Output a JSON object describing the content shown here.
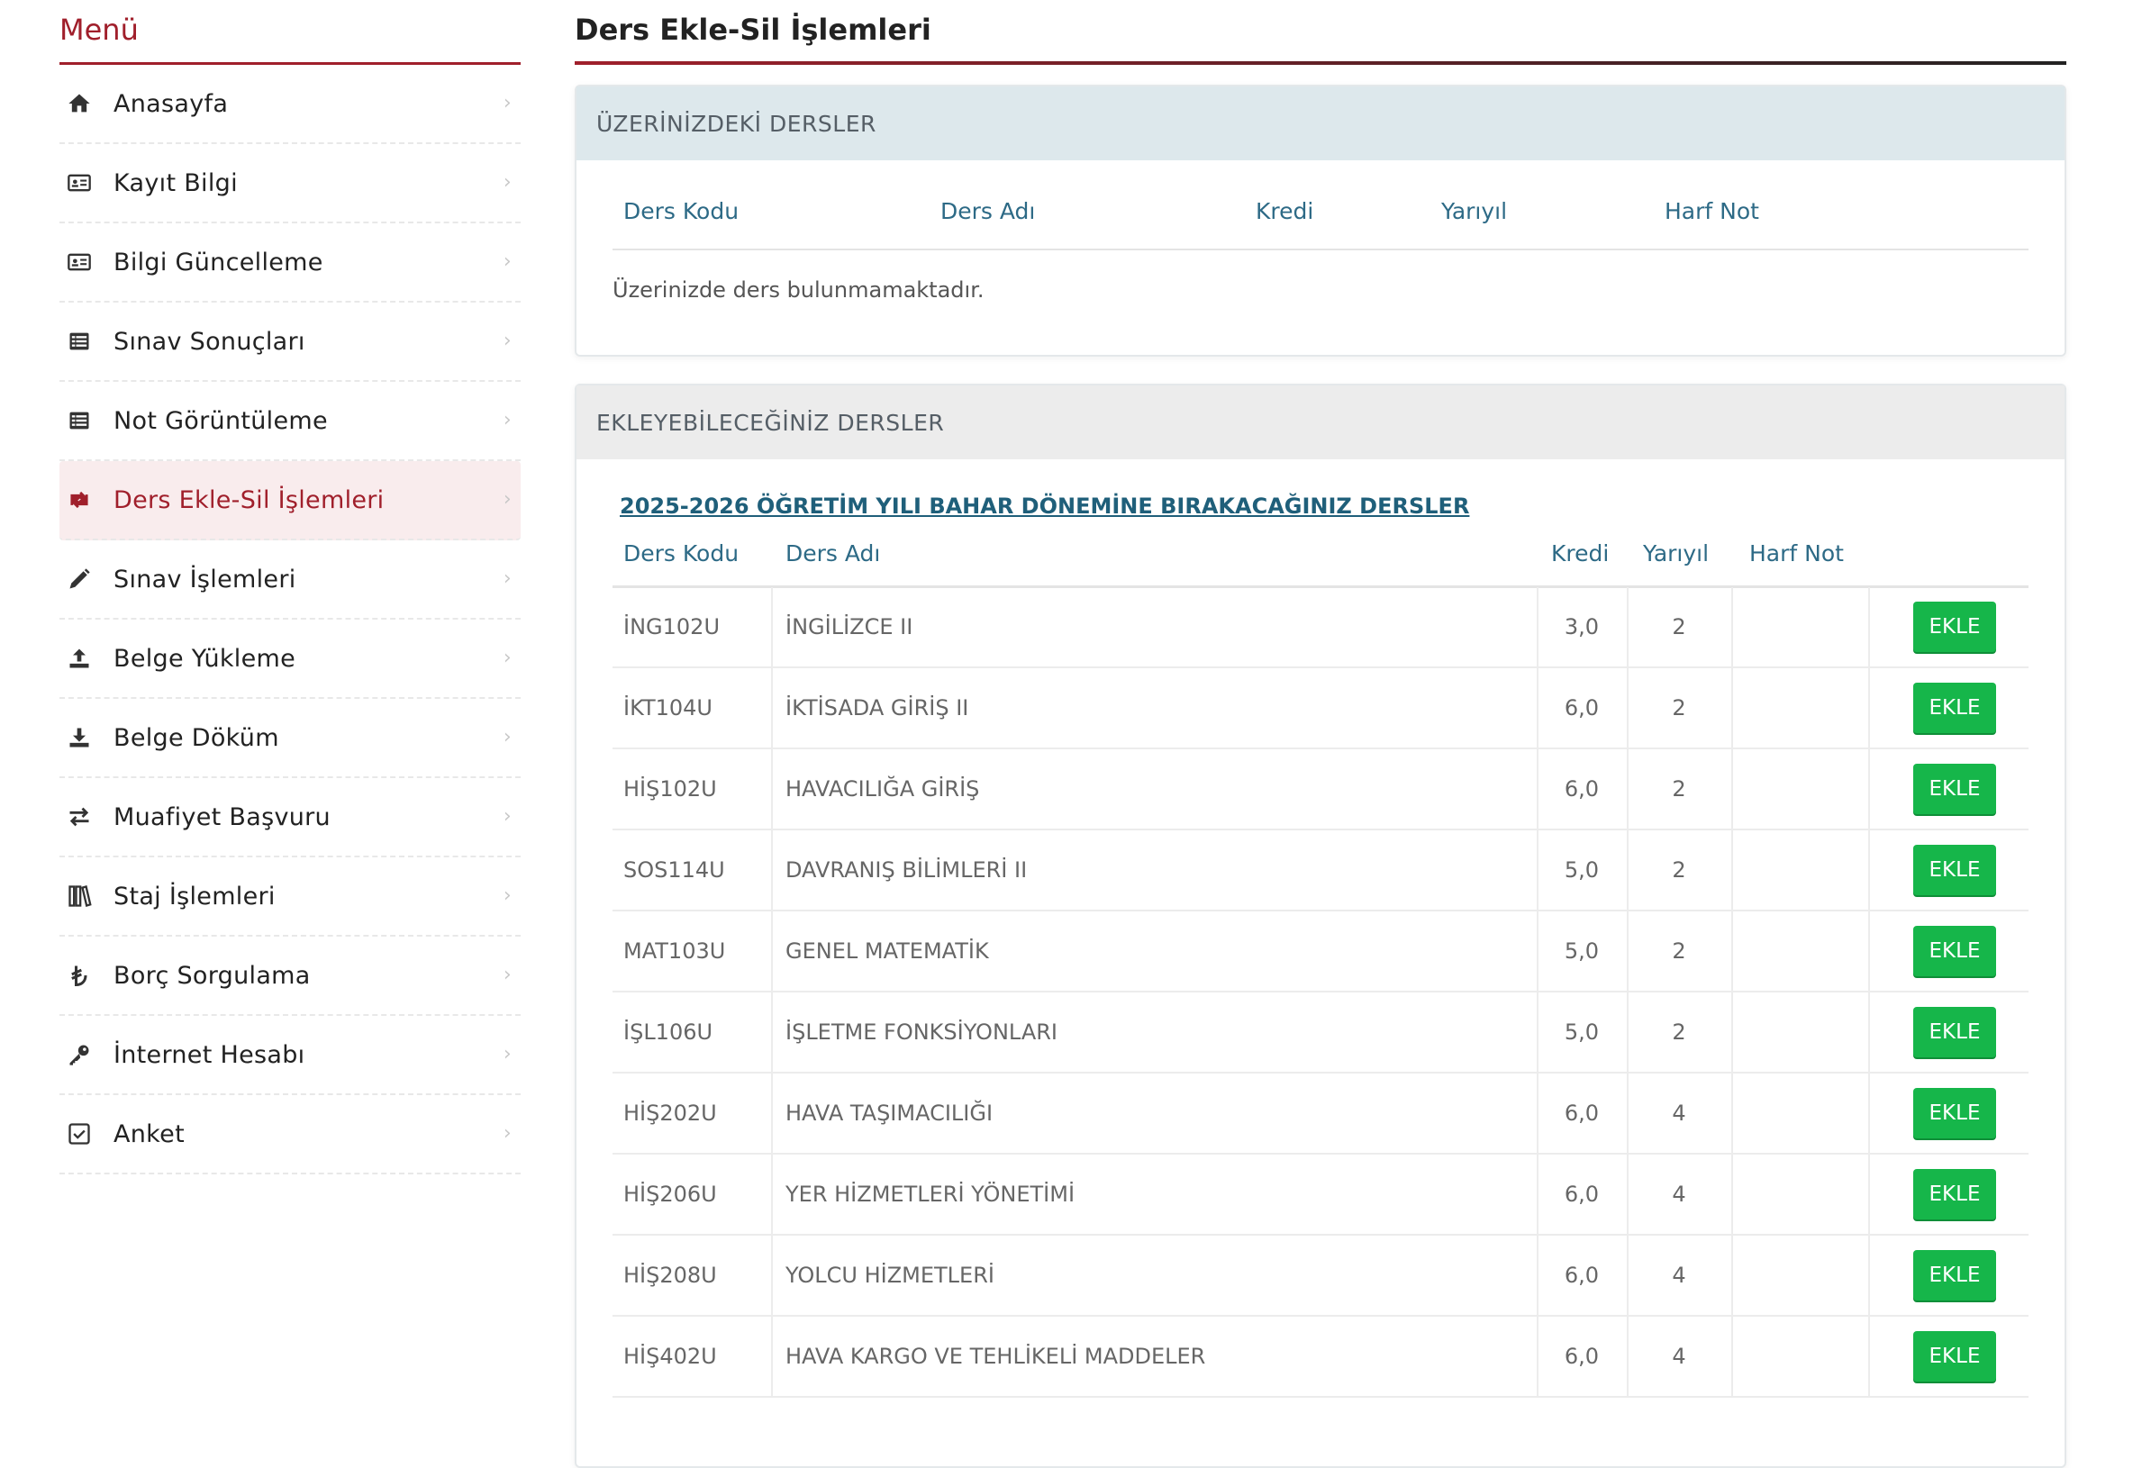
{
  "sidebar": {
    "title": "Menü",
    "items": [
      {
        "label": "Anasayfa",
        "icon": "home-icon"
      },
      {
        "label": "Kayıt Bilgi",
        "icon": "id-card-icon"
      },
      {
        "label": "Bilgi Güncelleme",
        "icon": "id-card-icon"
      },
      {
        "label": "Sınav Sonuçları",
        "icon": "list-icon"
      },
      {
        "label": "Not Görüntüleme",
        "icon": "list-icon"
      },
      {
        "label": "Ders Ekle-Sil İşlemleri",
        "icon": "retweet-icon",
        "active": true
      },
      {
        "label": "Sınav İşlemleri",
        "icon": "pencil-icon"
      },
      {
        "label": "Belge Yükleme",
        "icon": "upload-icon"
      },
      {
        "label": "Belge Döküm",
        "icon": "download-icon"
      },
      {
        "label": "Muafiyet Başvuru",
        "icon": "exchange-icon"
      },
      {
        "label": "Staj İşlemleri",
        "icon": "books-icon"
      },
      {
        "label": "Borç Sorgulama",
        "icon": "lira-icon"
      },
      {
        "label": "İnternet Hesabı",
        "icon": "key-icon"
      },
      {
        "label": "Anket",
        "icon": "checkbox-icon"
      }
    ]
  },
  "main": {
    "title": "Ders Ekle-Sil İşlemleri",
    "current_panel": {
      "title": "ÜZERİNİZDEKİ DERSLER",
      "columns": [
        "Ders Kodu",
        "Ders Adı",
        "Kredi",
        "Yarıyıl",
        "Harf Not"
      ],
      "empty_message": "Üzerinizde ders bulunmamaktadır."
    },
    "available_panel": {
      "title": "EKLEYEBİLECEĞİNİZ DERSLER",
      "subtitle_link": "2025-2026 ÖĞRETİM YILI BAHAR DÖNEMİNE BIRAKACAĞINIZ DERSLER",
      "columns": [
        "Ders Kodu",
        "Ders Adı",
        "Kredi",
        "Yarıyıl",
        "Harf Not"
      ],
      "add_label": "EKLE",
      "rows": [
        {
          "code": "İNG102U",
          "name": "İNGİLİZCE II",
          "credit": "3,0",
          "semester": "2",
          "grade": ""
        },
        {
          "code": "İKT104U",
          "name": "İKTİSADA GİRİŞ II",
          "credit": "6,0",
          "semester": "2",
          "grade": ""
        },
        {
          "code": "HİŞ102U",
          "name": "HAVACILIĞA GİRİŞ",
          "credit": "6,0",
          "semester": "2",
          "grade": ""
        },
        {
          "code": "SOS114U",
          "name": "DAVRANIŞ BİLİMLERİ II",
          "credit": "5,0",
          "semester": "2",
          "grade": ""
        },
        {
          "code": "MAT103U",
          "name": "GENEL MATEMATİK",
          "credit": "5,0",
          "semester": "2",
          "grade": ""
        },
        {
          "code": "İŞL106U",
          "name": "İŞLETME FONKSİYONLARI",
          "credit": "5,0",
          "semester": "2",
          "grade": ""
        },
        {
          "code": "HİŞ202U",
          "name": "HAVA TAŞIMACILIĞI",
          "credit": "6,0",
          "semester": "4",
          "grade": ""
        },
        {
          "code": "HİŞ206U",
          "name": "YER HİZMETLERİ YÖNETİMİ",
          "credit": "6,0",
          "semester": "4",
          "grade": ""
        },
        {
          "code": "HİŞ208U",
          "name": "YOLCU HİZMETLERİ",
          "credit": "6,0",
          "semester": "4",
          "grade": ""
        },
        {
          "code": "HİŞ402U",
          "name": "HAVA KARGO VE TEHLİKELİ MADDELER",
          "credit": "6,0",
          "semester": "4",
          "grade": ""
        }
      ]
    }
  },
  "colors": {
    "brand": "#a01f2b",
    "link": "#1f5f7a",
    "add_button": "#16b64a"
  }
}
